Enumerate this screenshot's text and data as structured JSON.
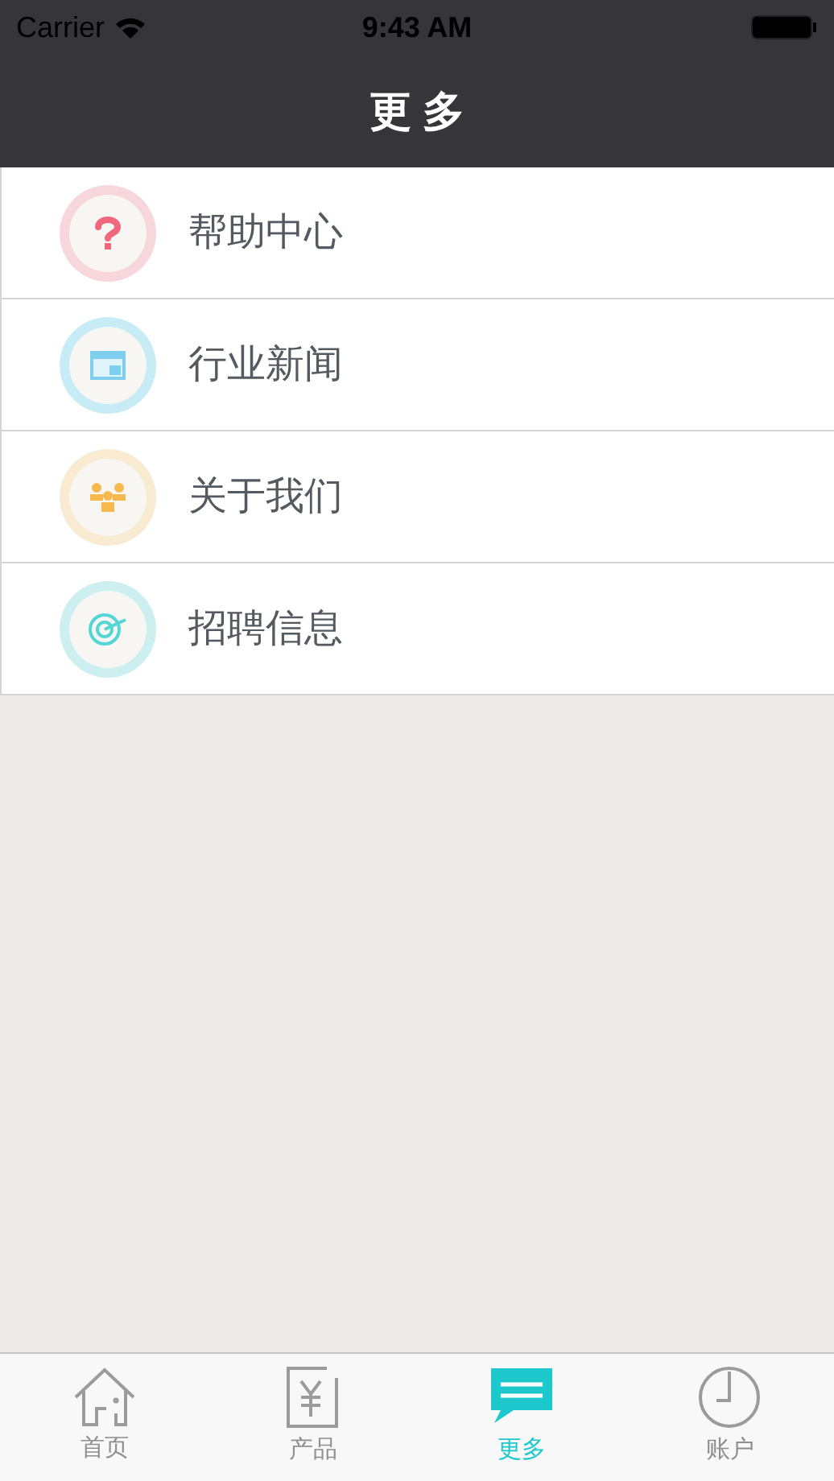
{
  "status_bar": {
    "carrier": "Carrier",
    "time": "9:43 AM"
  },
  "nav": {
    "title": "更 多"
  },
  "menu": [
    {
      "label": "帮助中心",
      "kind": "help",
      "color": "#f8d7dc"
    },
    {
      "label": "行业新闻",
      "kind": "news",
      "color": "#c8ecf6"
    },
    {
      "label": "关于我们",
      "kind": "team",
      "color": "#f9ead2"
    },
    {
      "label": "招聘信息",
      "kind": "target",
      "color": "#cdeff0"
    }
  ],
  "tabs": [
    {
      "label": "首页",
      "kind": "home",
      "selected": false
    },
    {
      "label": "产品",
      "kind": "product",
      "selected": false
    },
    {
      "label": "更多",
      "kind": "more",
      "selected": true
    },
    {
      "label": "账户",
      "kind": "account",
      "selected": false
    }
  ]
}
